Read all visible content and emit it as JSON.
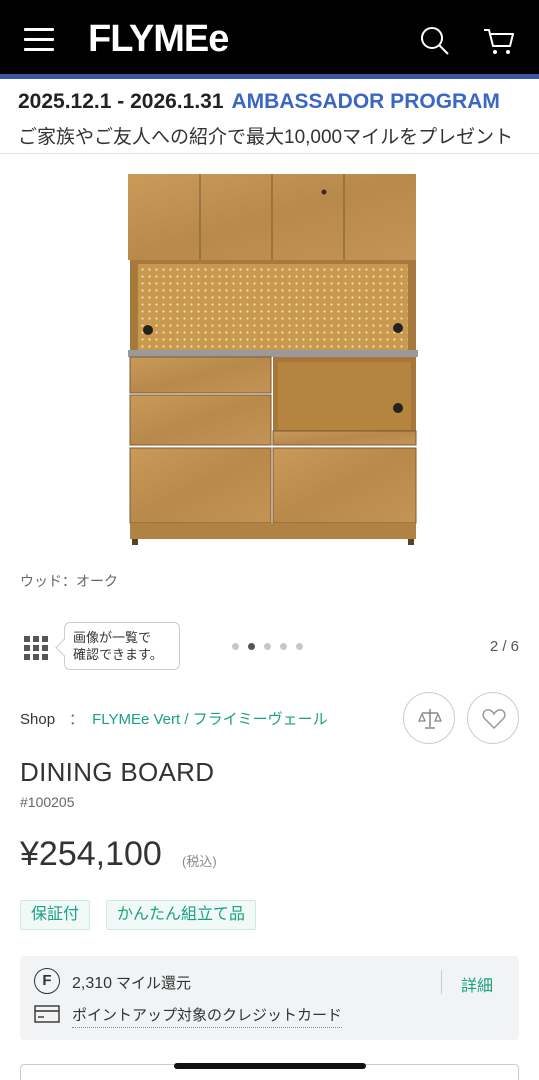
{
  "header": {
    "logo": "FLYMEe",
    "menu_icon": "hamburger-menu-icon",
    "search_icon": "search-icon",
    "cart_icon": "cart-icon"
  },
  "promo": {
    "date_range": "2025.12.1 - 2026.1.31",
    "program": "AMBASSADOR PROGRAM",
    "description": "ご家族やご友人への紹介で最大10,000マイルをプレゼント"
  },
  "gallery": {
    "caption": "ウッド：オーク",
    "tooltip_line1": "画像が一覧で",
    "tooltip_line2": "確認できます。",
    "counter": "2 / 6",
    "dot_count": 5,
    "active_dot": 1
  },
  "product": {
    "shop_label": "Shop",
    "shop_sep": "：",
    "shop_name": "FLYMEe Vert / フライミーヴェール",
    "name": "DINING BOARD",
    "sku": "#100205",
    "price": "¥254,100",
    "tax_note": "(税込)",
    "badges": [
      "保証付",
      "かんたん組立て品"
    ]
  },
  "points": {
    "icon_letter": "F",
    "amount": "2,310",
    "unit": "マイル還元",
    "detail": "詳細",
    "card_text": "ポイントアップ対象のクレジットカード"
  },
  "colors": {
    "header_bg": "#000000",
    "accent": "#3a56a6",
    "program": "#3a66c4",
    "link": "#1aa085"
  }
}
